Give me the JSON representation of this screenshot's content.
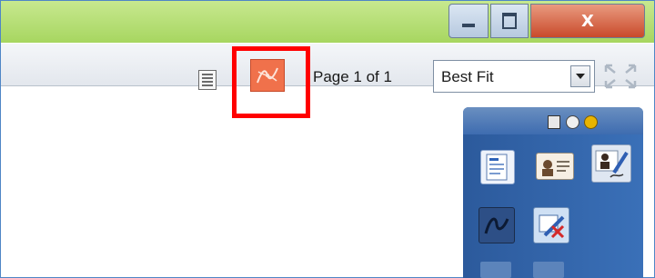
{
  "window": {
    "close_label": "X"
  },
  "toolbar": {
    "page_label": "Page 1 of 1",
    "zoom": {
      "selected": "Best Fit"
    }
  },
  "icons": {
    "pages": "pages-icon",
    "pdf": "pdf-icon",
    "fullscreen": "fullscreen-icon",
    "panel_pages": "pages-icon",
    "panel_minimize": "minimize-circle-icon",
    "panel_help": "help-circle-icon",
    "tools": [
      "document-form-icon",
      "id-card-icon",
      "signature-pen-icon",
      "draw-icon",
      "erase-icon",
      "tool-icon",
      "tool-icon"
    ]
  },
  "colors": {
    "titlebar": "#b6df78",
    "highlight": "#ff0000",
    "pdf_button": "#f0714b",
    "panel": "#2f60a6",
    "close_button": "#d4583a"
  }
}
